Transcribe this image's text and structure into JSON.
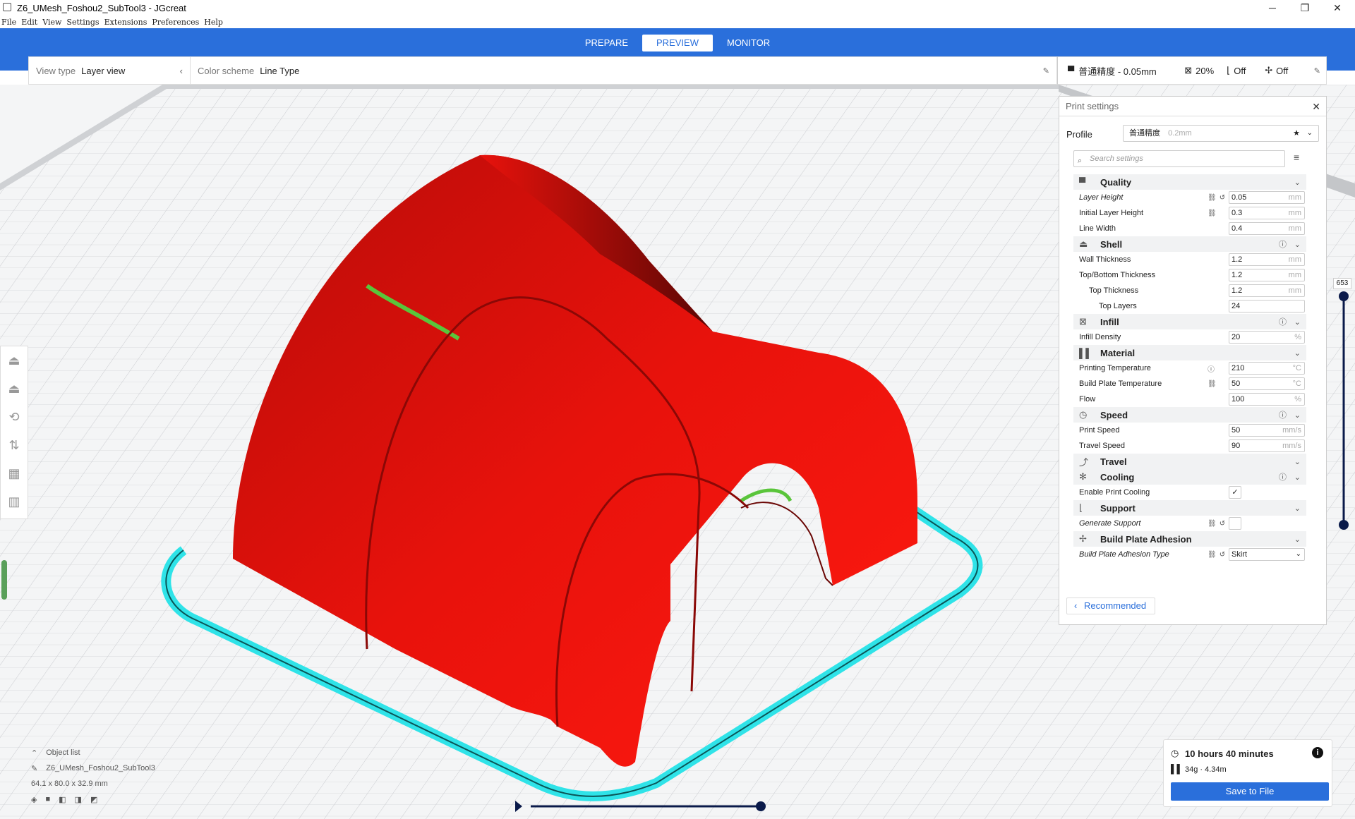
{
  "window": {
    "title": "Z6_UMesh_Foshou2_SubTool3 - JGcreat"
  },
  "menu": [
    "File",
    "Edit",
    "View",
    "Settings",
    "Extensions",
    "Preferences",
    "Help"
  ],
  "stages": [
    {
      "label": "PREPARE",
      "active": false
    },
    {
      "label": "PREVIEW",
      "active": true
    },
    {
      "label": "MONITOR",
      "active": false
    }
  ],
  "view": {
    "type_label": "View type",
    "type_value": "Layer view",
    "scheme_label": "Color scheme",
    "scheme_value": "Line Type"
  },
  "printbar": {
    "profile": "普通精度 - 0.05mm",
    "infill": "20%",
    "support": "Off",
    "adhesion": "Off"
  },
  "settings": {
    "title": "Print settings",
    "profile_label": "Profile",
    "profile_value": "普通精度",
    "profile_hint": "0.2mm",
    "search_placeholder": "Search settings",
    "recommended_label": "Recommended",
    "sections": [
      {
        "name": "Quality",
        "icon": "quality-icon",
        "glyph": "▀",
        "info": false,
        "rows": [
          {
            "label": "Layer Height",
            "value": "0.05",
            "unit": "mm",
            "italic": true,
            "indent": 0,
            "link": true,
            "reset": true
          },
          {
            "label": "Initial Layer Height",
            "value": "0.3",
            "unit": "mm",
            "italic": false,
            "indent": 0,
            "link": true,
            "reset": false
          },
          {
            "label": "Line Width",
            "value": "0.4",
            "unit": "mm",
            "italic": false,
            "indent": 0,
            "link": false,
            "reset": false
          }
        ]
      },
      {
        "name": "Shell",
        "icon": "shell-icon",
        "glyph": "⏏",
        "info": true,
        "rows": [
          {
            "label": "Wall Thickness",
            "value": "1.2",
            "unit": "mm",
            "italic": false,
            "indent": 0,
            "link": false,
            "reset": false
          },
          {
            "label": "Top/Bottom Thickness",
            "value": "1.2",
            "unit": "mm",
            "italic": false,
            "indent": 0,
            "link": false,
            "reset": false
          },
          {
            "label": "Top Thickness",
            "value": "1.2",
            "unit": "mm",
            "italic": false,
            "indent": 1,
            "link": false,
            "reset": false
          },
          {
            "label": "Top Layers",
            "value": "24",
            "unit": "",
            "italic": false,
            "indent": 2,
            "link": false,
            "reset": false
          }
        ]
      },
      {
        "name": "Infill",
        "icon": "infill-icon",
        "glyph": "⊠",
        "info": true,
        "rows": [
          {
            "label": "Infill Density",
            "value": "20",
            "unit": "%",
            "italic": false,
            "indent": 0,
            "link": false,
            "reset": false
          }
        ]
      },
      {
        "name": "Material",
        "icon": "material-icon",
        "glyph": "▌▌",
        "info": false,
        "rows": [
          {
            "label": "Printing Temperature",
            "value": "210",
            "unit": "°C",
            "italic": false,
            "indent": 0,
            "link": false,
            "reset": false,
            "info": true
          },
          {
            "label": "Build Plate Temperature",
            "value": "50",
            "unit": "°C",
            "italic": false,
            "indent": 0,
            "link": true,
            "reset": false
          },
          {
            "label": "Flow",
            "value": "100",
            "unit": "%",
            "italic": false,
            "indent": 0,
            "link": false,
            "reset": false
          }
        ]
      },
      {
        "name": "Speed",
        "icon": "speed-icon",
        "glyph": "◷",
        "info": true,
        "rows": [
          {
            "label": "Print Speed",
            "value": "50",
            "unit": "mm/s",
            "italic": false,
            "indent": 0,
            "link": false,
            "reset": false
          },
          {
            "label": "Travel Speed",
            "value": "90",
            "unit": "mm/s",
            "italic": false,
            "indent": 0,
            "link": false,
            "reset": false
          }
        ]
      },
      {
        "name": "Travel",
        "icon": "travel-icon",
        "glyph": "⤴",
        "info": false,
        "rows": []
      },
      {
        "name": "Cooling",
        "icon": "cooling-icon",
        "glyph": "✻",
        "info": true,
        "rows": [
          {
            "label": "Enable Print Cooling",
            "type": "checkbox",
            "checked": true,
            "italic": false,
            "indent": 0
          }
        ]
      },
      {
        "name": "Support",
        "icon": "support-icon",
        "glyph": "⌊",
        "info": false,
        "rows": [
          {
            "label": "Generate Support",
            "type": "checkbox",
            "checked": false,
            "italic": true,
            "indent": 0,
            "link": true,
            "reset": true
          }
        ]
      },
      {
        "name": "Build Plate Adhesion",
        "icon": "adhesion-icon",
        "glyph": "✢",
        "info": false,
        "rows": [
          {
            "label": "Build Plate Adhesion Type",
            "type": "select",
            "value": "Skirt",
            "italic": true,
            "indent": 0,
            "link": true,
            "reset": true
          }
        ]
      }
    ]
  },
  "layer_slider": {
    "value": "653"
  },
  "objects": {
    "header": "Object list",
    "name": "Z6_UMesh_Foshou2_SubTool3",
    "dims": "64.1 x 80.0 x 32.9 mm"
  },
  "print_info": {
    "time": "10 hours 40 minutes",
    "weight": "34g · 4.34m",
    "save_label": "Save to File"
  },
  "colors": {
    "accent": "#2a6fdb",
    "model": "#e8120c",
    "skirt": "#2fe3e8",
    "plate": "#f4f5f6"
  }
}
